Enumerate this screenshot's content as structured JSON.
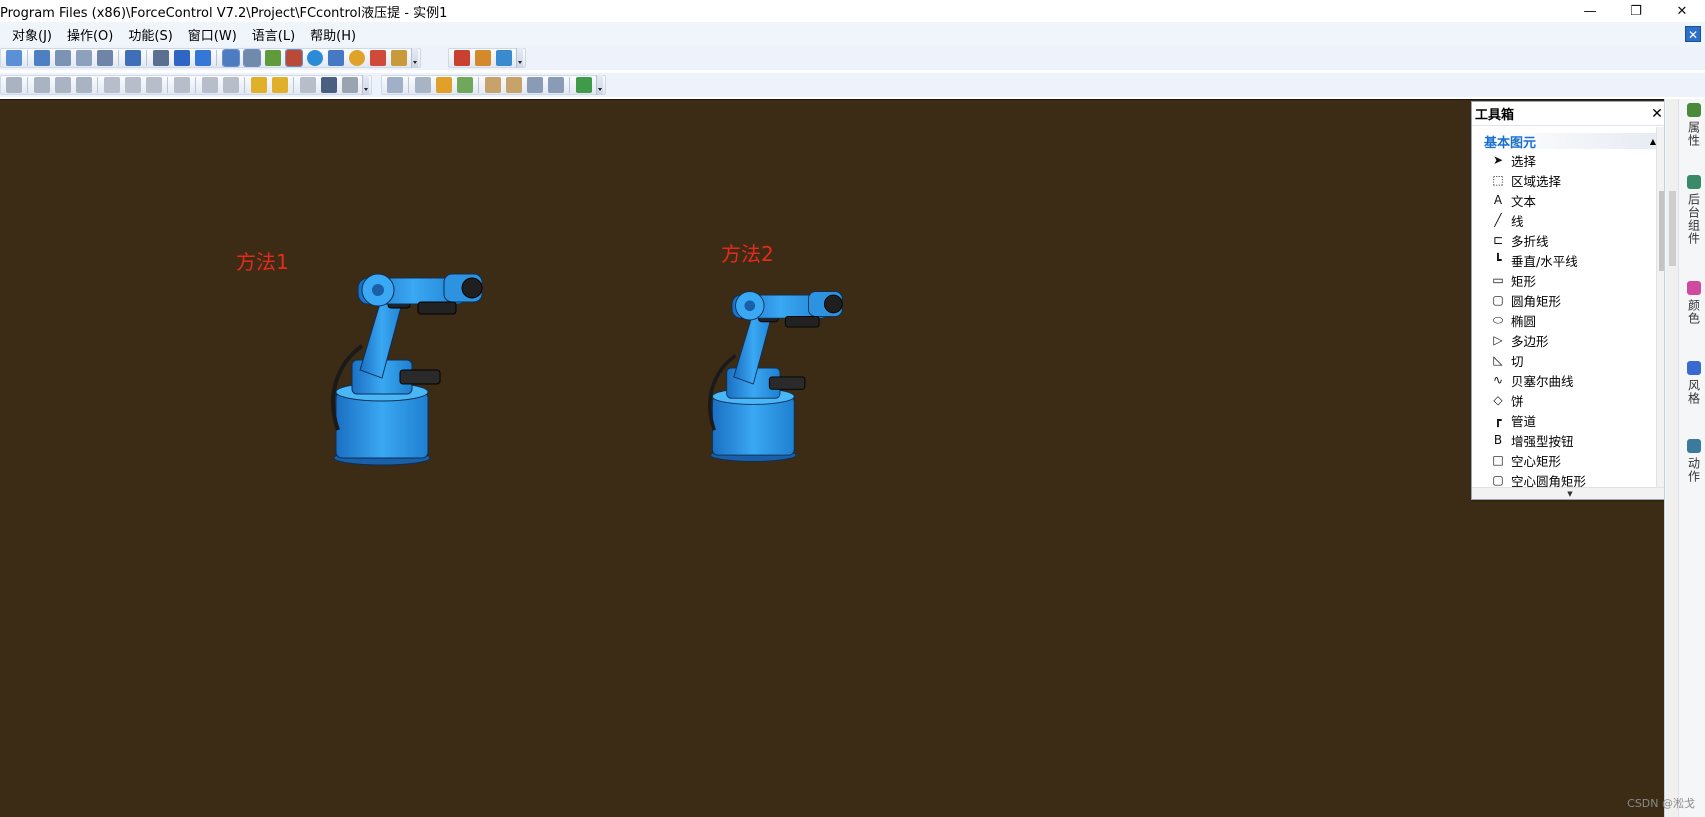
{
  "window": {
    "title": "Program Files (x86)\\ForceControl V7.2\\Project\\FCcontrol液压提 - 实例1",
    "controls": [
      "—",
      "❐",
      "✕"
    ]
  },
  "menu": {
    "items": [
      "对象(J)",
      "操作(O)",
      "功能(S)",
      "窗口(W)",
      "语言(L)",
      "帮助(H)"
    ],
    "close": "✕"
  },
  "canvas": {
    "background": "#3c2c15",
    "labels": [
      "方法1",
      "方法2"
    ],
    "label_color": "#e52b1e"
  },
  "toolbox": {
    "title": "工具箱",
    "close": "✕",
    "group": "基本图元",
    "group_caret": "▲",
    "footer_caret": "▼",
    "items": [
      {
        "label": "选择",
        "icon": "arrow-icon",
        "glyph": "➤"
      },
      {
        "label": "区域选择",
        "icon": "region-select-icon",
        "glyph": "⬚"
      },
      {
        "label": "文本",
        "icon": "text-icon",
        "glyph": "A"
      },
      {
        "label": "线",
        "icon": "line-icon",
        "glyph": "╱"
      },
      {
        "label": "多折线",
        "icon": "polyline-icon",
        "glyph": "⊏"
      },
      {
        "label": "垂直/水平线",
        "icon": "orthogonal-line-icon",
        "glyph": "┗"
      },
      {
        "label": "矩形",
        "icon": "rectangle-icon",
        "glyph": "▭"
      },
      {
        "label": "圆角矩形",
        "icon": "rounded-rectangle-icon",
        "glyph": "▢"
      },
      {
        "label": "椭圆",
        "icon": "ellipse-icon",
        "glyph": "⬭"
      },
      {
        "label": "多边形",
        "icon": "polygon-icon",
        "glyph": "▷"
      },
      {
        "label": "切",
        "icon": "chord-icon",
        "glyph": "◺"
      },
      {
        "label": "贝塞尔曲线",
        "icon": "bezier-icon",
        "glyph": "∿"
      },
      {
        "label": "饼",
        "icon": "pie-icon",
        "glyph": "◇"
      },
      {
        "label": "管道",
        "icon": "pipe-icon",
        "glyph": "┏"
      },
      {
        "label": "增强型按钮",
        "icon": "enhanced-button-icon",
        "glyph": "B"
      },
      {
        "label": "空心矩形",
        "icon": "hollow-rectangle-icon",
        "glyph": "□"
      },
      {
        "label": "空心圆角矩形",
        "icon": "hollow-rounded-rectangle-icon",
        "glyph": "▢"
      }
    ]
  },
  "right_dock": {
    "tabs": [
      {
        "label": "属性",
        "color": "#4a8a3a"
      },
      {
        "label": "后台组件",
        "color": "#3a8a6a"
      },
      {
        "label": "颜色",
        "color": "#d04aa0"
      },
      {
        "label": "风格",
        "color": "#3a6ad0"
      },
      {
        "label": "动作",
        "color": "#3a7a9a"
      }
    ]
  },
  "watermark": "CSDN @淞戈"
}
